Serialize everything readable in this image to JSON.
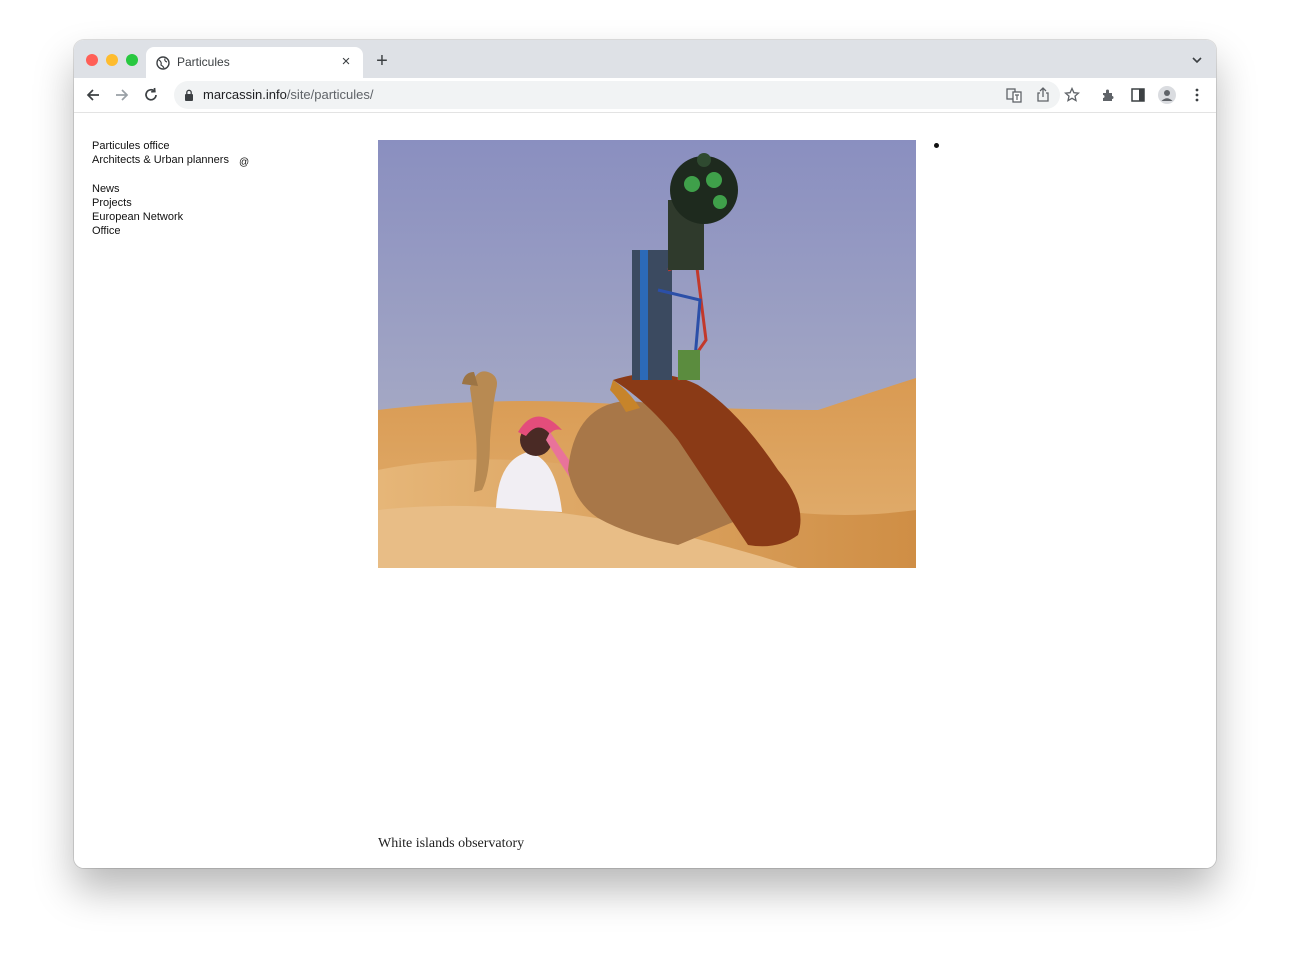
{
  "browser": {
    "tab": {
      "title": "Particules",
      "icon": "globe-icon",
      "close_icon": "close-icon"
    },
    "new_tab_icon": "plus-icon",
    "tab_list_icon": "chevron-down-icon",
    "address": {
      "host": "marcassin.info",
      "path": "/site/particules/"
    },
    "toolbar_icons": [
      "translate-icon",
      "share-icon",
      "bookmark-star-icon",
      "extensions-icon",
      "side-panel-icon",
      "profile-icon",
      "kebab-menu-icon"
    ]
  },
  "site": {
    "name": "Particules office",
    "tagline": "Architects & Urban planners",
    "nav": [
      "News",
      "Projects",
      "European Network",
      "Office"
    ],
    "at_symbol": "@"
  },
  "main": {
    "image_alt": "camel carrying street-view camera in desert dunes",
    "caption": "White islands observatory"
  },
  "colors": {
    "tabstrip": "#dee1e6",
    "omnibox": "#f1f3f4",
    "text": "#111111",
    "sky": "#8c93c2",
    "sand": "#d9a05e"
  }
}
